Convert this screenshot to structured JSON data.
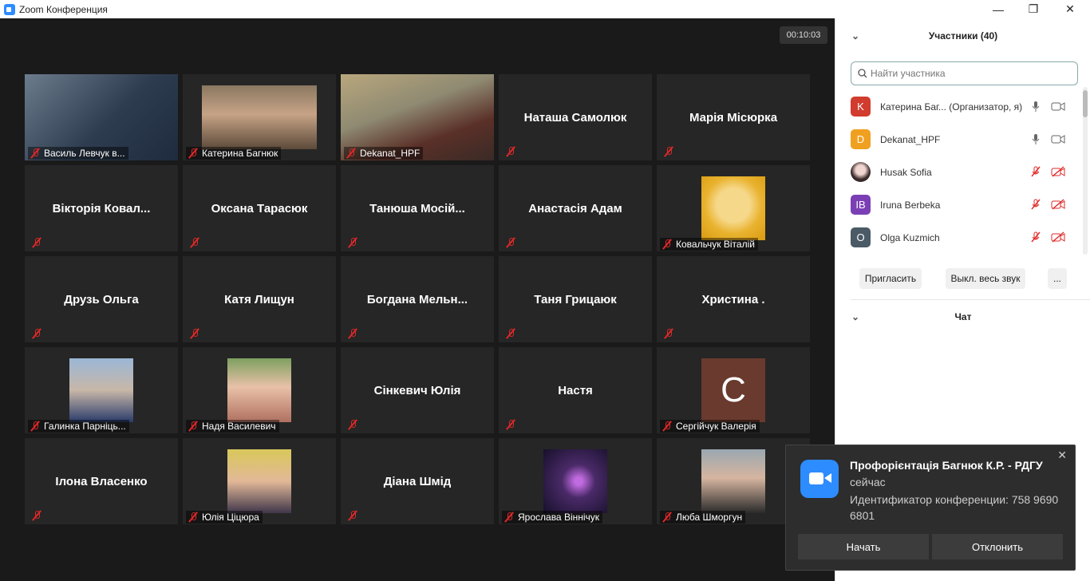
{
  "window": {
    "title": "Zoom Конференция",
    "minimize": "—",
    "restore": "❐",
    "close": "✕"
  },
  "meeting": {
    "timer": "00:10:03"
  },
  "tiles": [
    {
      "name": "Василь Левчук в...",
      "has_photo": true
    },
    {
      "name": "Катерина Багнюк",
      "has_photo": true
    },
    {
      "name": "Dekanat_HPF",
      "has_photo": true,
      "active_speaker": true
    },
    {
      "name": "Наташа Самолюк"
    },
    {
      "name": "Марія Місюрка"
    },
    {
      "name": "Вікторія Ковал..."
    },
    {
      "name": "Оксана Тарасюк"
    },
    {
      "name": "Танюша  Мосій..."
    },
    {
      "name": "Анастасія Адам"
    },
    {
      "name": "Ковальчук Віталій",
      "has_photo": true
    },
    {
      "name": "Друзь Ольга"
    },
    {
      "name": "Катя Лищун"
    },
    {
      "name": "Богдана  Мельн..."
    },
    {
      "name": "Таня Грицаюк"
    },
    {
      "name": "Христина ."
    },
    {
      "name": "Галинка Парніць...",
      "has_photo": true
    },
    {
      "name": "Надя Василевич",
      "has_photo": true
    },
    {
      "name": "Сінкевич Юлія"
    },
    {
      "name": "Настя"
    },
    {
      "name": "Сергійчук Валерія",
      "has_photo": true,
      "initial": "C"
    },
    {
      "name": "Ілона Власенко"
    },
    {
      "name": "Юлія Ціцюра",
      "has_photo": true
    },
    {
      "name": "Діана Шмід"
    },
    {
      "name": "Ярослава Віннічук",
      "has_photo": true
    },
    {
      "name": "Люба Шморгун",
      "has_photo": true
    }
  ],
  "participants_panel": {
    "title": "Участники (40)",
    "search_placeholder": "Найти участника",
    "list": [
      {
        "initial": "K",
        "color": "#d13c2e",
        "name": "Катерина Баг...  (Организатор, я)",
        "mic": "on",
        "video": "on"
      },
      {
        "initial": "D",
        "color": "#f0a020",
        "name": "Dekanat_HPF",
        "mic": "on",
        "video": "on"
      },
      {
        "initial": "",
        "color": "#d9a7b0",
        "name": "Husak Sofia",
        "mic": "muted",
        "video": "off"
      },
      {
        "initial": "IB",
        "color": "#7b3fb5",
        "name": "Iruna Berbeka",
        "mic": "muted",
        "video": "off"
      },
      {
        "initial": "O",
        "color": "#4a5a66",
        "name": "Olga Kuzmich",
        "mic": "muted",
        "video": "off"
      }
    ],
    "invite_label": "Пригласить",
    "mute_all_label": "Выкл. весь звук",
    "more_label": "...",
    "chat_title": "Чат"
  },
  "notification": {
    "title": "Профорієнтація Багнюк К.Р. - РДГУ",
    "subtitle": "сейчас",
    "meeting_id": "Идентификатор конференции: 758 9690 6801",
    "start_label": "Начать",
    "decline_label": "Отклонить",
    "close": "✕"
  },
  "colors": {
    "accent": "#2d8cff",
    "mute_red": "#e02828",
    "active_outline": "#e8e87a"
  }
}
